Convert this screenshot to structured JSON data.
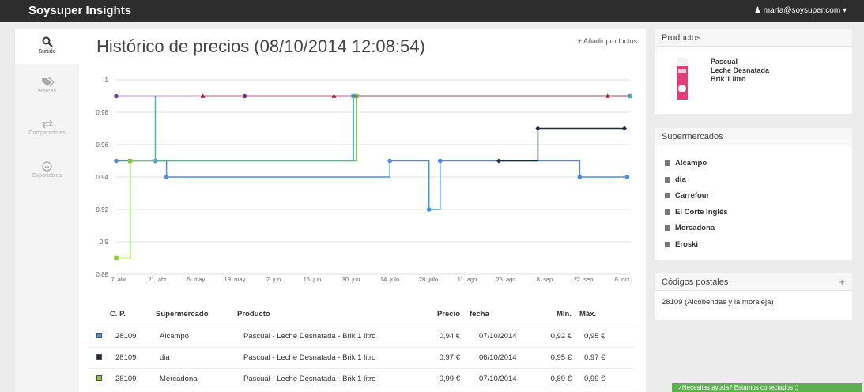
{
  "topbar": {
    "brand": "Soysuper Insights",
    "user": "marta@soysuper.com"
  },
  "sidebar": {
    "items": [
      {
        "name": "surtido",
        "label": "Surtido",
        "icon": "search-icon",
        "active": true
      },
      {
        "name": "marcas",
        "label": "Marcas",
        "icon": "tags-icon",
        "active": false
      },
      {
        "name": "comparadores",
        "label": "Comparadores",
        "icon": "exchange-icon",
        "active": false
      },
      {
        "name": "exportables",
        "label": "Exportables",
        "icon": "download-icon",
        "active": false
      }
    ]
  },
  "main": {
    "title": "Histórico de precios (08/10/2014 12:08:54)",
    "add_label": "Añadir productos"
  },
  "chart_data": {
    "type": "line",
    "x_ticks": [
      "7. abr",
      "21. abr",
      "5. may",
      "19. may",
      "2. jun",
      "16. jun",
      "30. jun",
      "14. julo",
      "28. julo",
      "11. ago",
      "25. ago",
      "8. sep",
      "22. sep",
      "6. oct"
    ],
    "y_ticks": [
      "0.88",
      "0.9",
      "0.92",
      "0.94",
      "0.96",
      "0.98",
      "1"
    ],
    "ylim": [
      0.88,
      1.0
    ],
    "xlim": [
      "2014-04-07",
      "2014-10-08"
    ],
    "grid": true,
    "series": [
      {
        "color": "#4b8fd6",
        "step": true,
        "points": [
          [
            "2014-04-07",
            0.95
          ],
          [
            "2014-04-21",
            0.95
          ],
          [
            "2014-04-25",
            0.94
          ],
          [
            "2014-07-14",
            0.95
          ],
          [
            "2014-07-28",
            0.92
          ],
          [
            "2014-08-01",
            0.95
          ],
          [
            "2014-08-22",
            0.95
          ],
          [
            "2014-09-20",
            0.94
          ],
          [
            "2014-10-07",
            0.94
          ]
        ],
        "markers": [
          [
            "2014-04-07",
            0.95
          ],
          [
            "2014-04-21",
            0.95
          ],
          [
            "2014-04-25",
            0.94
          ],
          [
            "2014-07-14",
            0.95
          ],
          [
            "2014-07-28",
            0.92
          ],
          [
            "2014-08-01",
            0.95
          ],
          [
            "2014-09-20",
            0.94
          ],
          [
            "2014-10-07",
            0.94
          ]
        ],
        "marker": "circle"
      },
      {
        "color": "#1c2a3a",
        "step": true,
        "points": [
          [
            "2014-08-22",
            0.95
          ],
          [
            "2014-09-05",
            0.97
          ],
          [
            "2014-10-06",
            0.97
          ]
        ],
        "markers": [
          [
            "2014-08-22",
            0.95
          ],
          [
            "2014-09-05",
            0.97
          ],
          [
            "2014-10-06",
            0.97
          ]
        ],
        "marker": "diamond"
      },
      {
        "color": "#8dc63f",
        "step": true,
        "points": [
          [
            "2014-04-07",
            0.89
          ],
          [
            "2014-04-12",
            0.95
          ],
          [
            "2014-07-02",
            0.99
          ],
          [
            "2014-10-07",
            0.99
          ]
        ],
        "markers": [
          [
            "2014-04-07",
            0.89
          ],
          [
            "2014-04-12",
            0.95
          ],
          [
            "2014-07-02",
            0.99
          ]
        ],
        "marker": "square"
      },
      {
        "color": "#3bbcc4",
        "step": true,
        "points": [
          [
            "2014-04-21",
            0.99
          ],
          [
            "2014-04-21",
            0.95
          ],
          [
            "2014-07-01",
            0.95
          ],
          [
            "2014-07-01",
            0.99
          ],
          [
            "2014-10-08",
            0.99
          ]
        ],
        "markers": [
          [
            "2014-07-01",
            0.99
          ],
          [
            "2014-10-08",
            0.99
          ]
        ],
        "marker": "square"
      },
      {
        "color": "#6a3f8f",
        "step": false,
        "points": [
          [
            "2014-04-07",
            0.99
          ],
          [
            "2014-10-08",
            0.99
          ]
        ],
        "markers": [
          [
            "2014-04-07",
            0.99
          ],
          [
            "2014-05-23",
            0.99
          ]
        ],
        "marker": "circle"
      },
      {
        "color": "#a8203a",
        "step": false,
        "points": [
          [
            "2014-05-08",
            0.99
          ],
          [
            "2014-10-08",
            0.99
          ]
        ],
        "markers": [
          [
            "2014-05-08",
            0.99
          ],
          [
            "2014-06-24",
            0.99
          ],
          [
            "2014-09-30",
            0.99
          ]
        ],
        "marker": "triangle"
      }
    ]
  },
  "table": {
    "headers": [
      "C. P.",
      "Supermercado",
      "Producto",
      "Precio",
      "fecha",
      "Mín.",
      "Máx."
    ],
    "rows": [
      {
        "color": "#4b8fd6",
        "cp": "28109",
        "super": "Alcampo",
        "product": "Pascual - Leche Desnatada - Brik 1 litro",
        "price": "0,94 €",
        "date": "07/10/2014",
        "min": "0,92 €",
        "max": "0,95 €"
      },
      {
        "color": "#1c2a3a",
        "cp": "28109",
        "super": "dia",
        "product": "Pascual - Leche Desnatada - Brik 1 litro",
        "price": "0,97 €",
        "date": "06/10/2014",
        "min": "0,95 €",
        "max": "0,97 €"
      },
      {
        "color": "#8dc63f",
        "cp": "28109",
        "super": "Mercadona",
        "product": "Pascual - Leche Desnatada - Brik 1 litro",
        "price": "0,99 €",
        "date": "07/10/2014",
        "min": "0,89 €",
        "max": "0,99 €"
      }
    ]
  },
  "productos": {
    "header": "Productos",
    "line1": "Pascual",
    "line2": "Leche Desnatada",
    "line3": "Brik 1 litro"
  },
  "supermercados": {
    "header": "Supermercados",
    "items": [
      "Alcampo",
      "dia",
      "Carrefour",
      "El Corte Inglés",
      "Mercadona",
      "Eroski"
    ]
  },
  "codigos": {
    "header": "Códigos postales",
    "value": "28109 (Alcobendas y la moraleja)"
  },
  "help": {
    "label": "¿Necesitas ayuda? Estamos conectados :)"
  }
}
